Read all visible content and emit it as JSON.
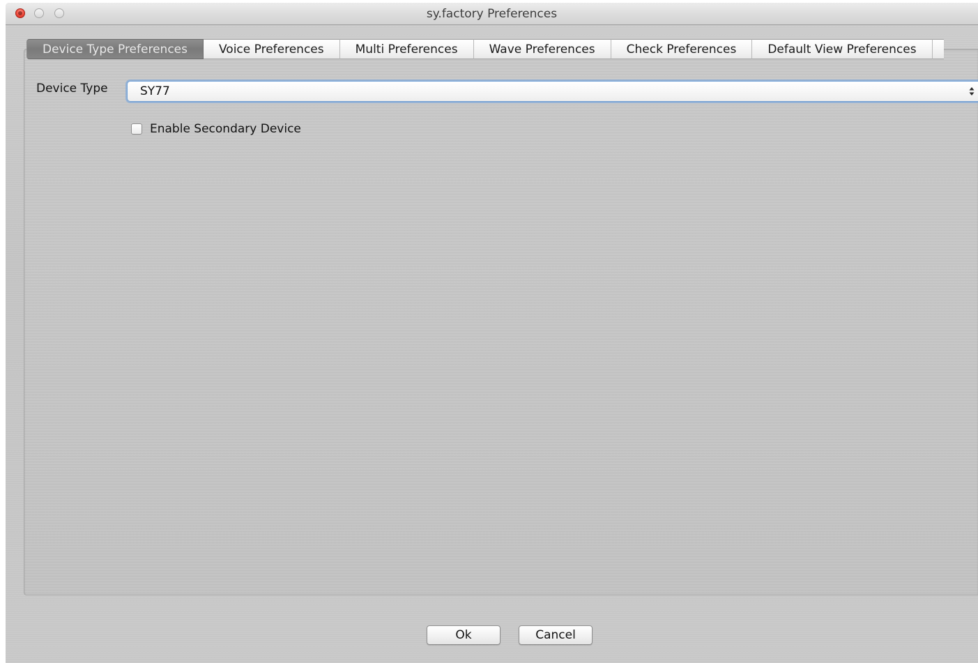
{
  "window": {
    "title": "sy.factory Preferences"
  },
  "tabs": [
    {
      "label": "Device Type Preferences",
      "active": true
    },
    {
      "label": "Voice Preferences",
      "active": false
    },
    {
      "label": "Multi Preferences",
      "active": false
    },
    {
      "label": "Wave Preferences",
      "active": false
    },
    {
      "label": "Check Preferences",
      "active": false
    },
    {
      "label": "Default View Preferences",
      "active": false
    }
  ],
  "form": {
    "device_type_label": "Device Type",
    "device_type_value": "SY77",
    "secondary_checkbox_label": "Enable Secondary Device",
    "secondary_checked": false
  },
  "buttons": {
    "ok_label": "Ok",
    "cancel_label": "Cancel"
  },
  "colors": {
    "focus_ring": "#6f9fd4",
    "close_button": "#f04a3c",
    "active_tab": "#858585"
  }
}
